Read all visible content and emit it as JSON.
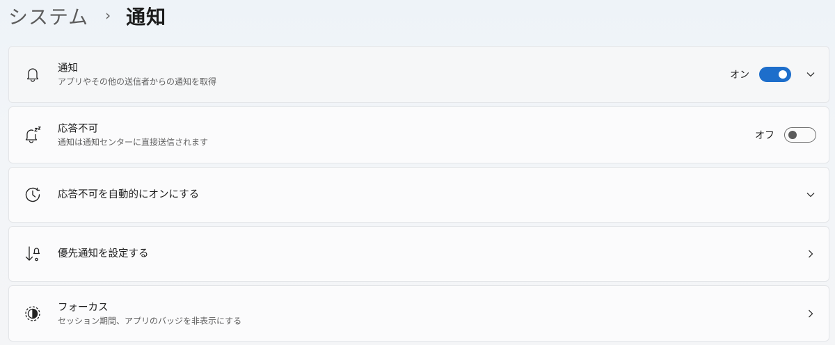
{
  "breadcrumb": {
    "parent": "システム",
    "separator": "›",
    "current": "通知"
  },
  "settings": [
    {
      "icon": "bell-icon",
      "title": "通知",
      "subtitle": "アプリやその他の送信者からの通知を取得",
      "state_label": "オン",
      "toggle": "on",
      "trailing": "chevron-down"
    },
    {
      "icon": "bell-snooze-icon",
      "title": "応答不可",
      "subtitle": "通知は通知センターに直接送信されます",
      "state_label": "オフ",
      "toggle": "off"
    },
    {
      "icon": "clock-icon",
      "title": "応答不可を自動的にオンにする",
      "trailing": "chevron-down"
    },
    {
      "icon": "priority-icon",
      "title": "優先通知を設定する",
      "trailing": "chevron-right"
    },
    {
      "icon": "focus-icon",
      "title": "フォーカス",
      "subtitle": "セッション期間、アプリのバッジを非表示にする",
      "trailing": "chevron-right"
    }
  ],
  "colors": {
    "accent": "#1d6ecb",
    "card_background": "#fbfbfc",
    "page_background": "#f2f5f8"
  }
}
